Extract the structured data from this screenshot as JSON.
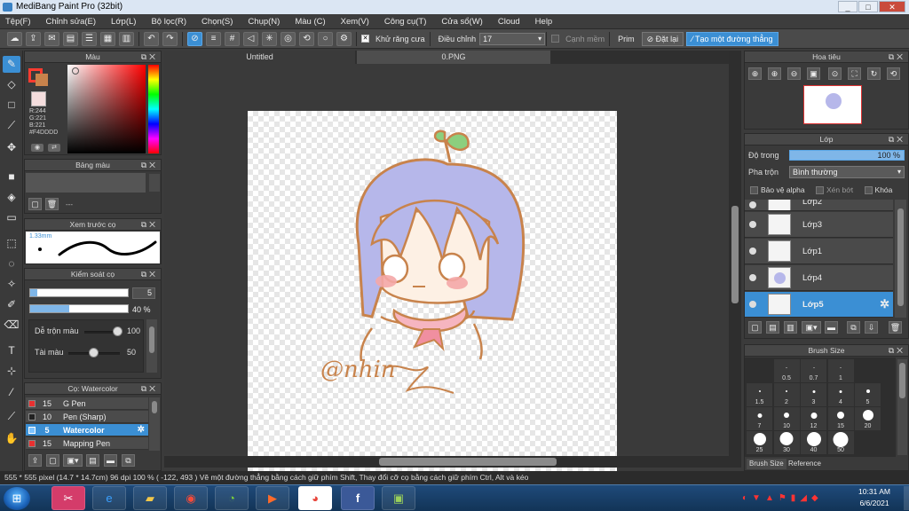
{
  "window": {
    "title": "MediBang Paint Pro (32bit)",
    "min": "_",
    "max": "□",
    "close": "✕"
  },
  "menu": [
    "Tệp(F)",
    "Chỉnh sửa(E)",
    "Lớp(L)",
    "Bộ lọc(R)",
    "Chọn(S)",
    "Chụp(N)",
    "Màu (C)",
    "Xem(V)",
    "Công cụ(T)",
    "Cửa sổ(W)",
    "Cloud",
    "Help"
  ],
  "toolbar": {
    "anti_alias": "Khử răng cưa",
    "adjust_label": "Điều chỉnh",
    "adjust_value": "17",
    "edge": "Cạnh mềm",
    "prim_label": "Prim",
    "reset": "Đặt lại",
    "straight_line": "Tạo một đường thẳng"
  },
  "color_panel": {
    "title": "Màu",
    "r": "R:244",
    "g": "G:221",
    "b": "B:221",
    "hex": "#F4DDDD",
    "primary": "#ff3b30",
    "secondary": "#f4dddd"
  },
  "palette_panel": {
    "title": "Bảng màu",
    "empty": "---"
  },
  "brush_preview": {
    "title": "Xem trước cọ",
    "size": "1.33mm"
  },
  "brush_control": {
    "title": "Kiểm soát cọ",
    "size_value": "5",
    "opacity_value": "40 %",
    "opacity": 0.4,
    "blend_label": "Dễ trộn màu",
    "blend_value": "100",
    "paint_label": "Tài màu",
    "paint_value": "50"
  },
  "brush_list": {
    "title": "Cọ: Watercolor",
    "items": [
      {
        "num": "15",
        "name": "G Pen",
        "color": "#e83030"
      },
      {
        "num": "10",
        "name": "Pen (Sharp)",
        "color": "#222222"
      },
      {
        "num": "5",
        "name": "Watercolor",
        "color": "#3b8fd4"
      },
      {
        "num": "15",
        "name": "Mapping Pen",
        "color": "#e83030"
      }
    ]
  },
  "doc_tabs": [
    "Untitled",
    "0.PNG"
  ],
  "artwork": {
    "signature": "@nhin"
  },
  "navigator": {
    "title": "Hoa tiêu"
  },
  "layers": {
    "title": "Lớp",
    "opacity_label": "Độ trong",
    "opacity_value": "100 %",
    "blend_label": "Pha trộn",
    "blend_value": "Bình thường",
    "protect_alpha": "Bảo vệ alpha",
    "clip": "Xén bớt",
    "lock": "Khóa",
    "items": [
      "Lớp2",
      "Lớp3",
      "Lớp1",
      "Lớp4",
      "Lớp5"
    ]
  },
  "brush_size": {
    "title": "Brush Size",
    "sizes": [
      "0.5",
      "0.7",
      "1",
      "1.5",
      "2",
      "3",
      "4",
      "5",
      "7",
      "10",
      "12",
      "15",
      "20",
      "25",
      "30",
      "40",
      "50"
    ],
    "tabs": [
      "Brush Size",
      "Reference"
    ]
  },
  "status": {
    "text": "555 * 555 pixel   (14.7 * 14.7cm)   96 dpi   100 %   ( -122, 493 )   Vẽ một đường thẳng bằng cách giữ phím Shift, Thay đổi cỡ cọ bằng cách giữ phím Ctrl, Alt và kéo"
  },
  "taskbar": {
    "time": "10:31 AM",
    "date": "6/6/2021"
  }
}
